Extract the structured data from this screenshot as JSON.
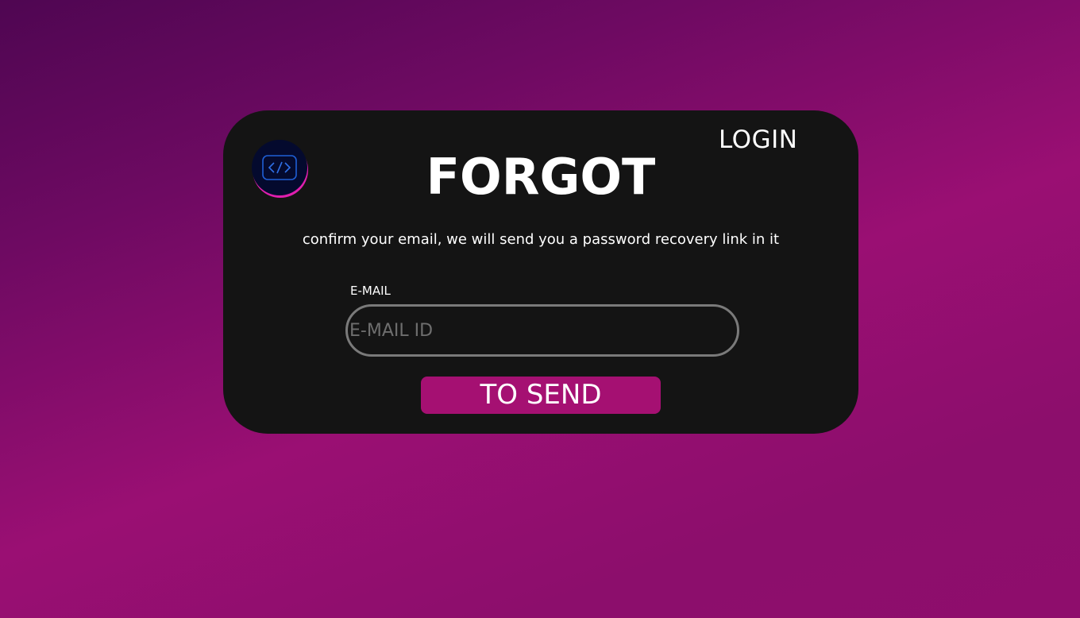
{
  "header": {
    "login_label": "LOGIN",
    "title": "FORGOT"
  },
  "logo": {
    "icon": "code-brackets-icon"
  },
  "form": {
    "description": "confirm your email, we will send you a password recovery link in it",
    "email_label": "E-MAIL",
    "email_placeholder": "E-MAIL ID",
    "email_value": "",
    "submit_label": "TO SEND"
  },
  "colors": {
    "card_background": "#141414",
    "accent": "#a51072",
    "gradient_start": "#4f0652",
    "gradient_end": "#8e0d6c",
    "logo_ring": "#e01fae",
    "logo_icon": "#1f5fd6"
  }
}
